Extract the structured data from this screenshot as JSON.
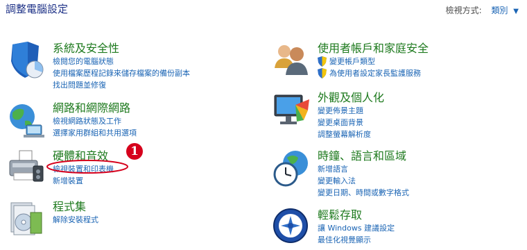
{
  "window": {
    "title": "調整電腦設定"
  },
  "view": {
    "label": "檢視方式:",
    "mode": "類別"
  },
  "annotation": {
    "number": "1"
  },
  "categories": [
    {
      "heading": "系統及安全性",
      "links": [
        "檢閱您的電腦狀態",
        "使用檔案歷程記錄來儲存檔案的備份副本",
        "找出問題並修復"
      ]
    },
    {
      "heading": "網路和網際網路",
      "links": [
        "檢視網路狀態及工作",
        "選擇家用群組和共用選項"
      ]
    },
    {
      "heading": "硬體和音效",
      "links": [
        "檢視裝置和印表機",
        "新增裝置"
      ]
    },
    {
      "heading": "程式集",
      "links": [
        "解除安裝程式"
      ]
    },
    {
      "heading": "使用者帳戶和家庭安全",
      "links": [
        "變更帳戶類型",
        "為使用者設定家長監護服務"
      ]
    },
    {
      "heading": "外觀及個人化",
      "links": [
        "變更佈景主題",
        "變更桌面背景",
        "調整螢幕解析度"
      ]
    },
    {
      "heading": "時鐘、語言和區域",
      "links": [
        "新增語言",
        "變更輸入法",
        "變更日期、時間或數字格式"
      ]
    },
    {
      "heading": "輕鬆存取",
      "links": [
        "讓 Windows 建議設定",
        "最佳化視覺顯示"
      ]
    }
  ]
}
